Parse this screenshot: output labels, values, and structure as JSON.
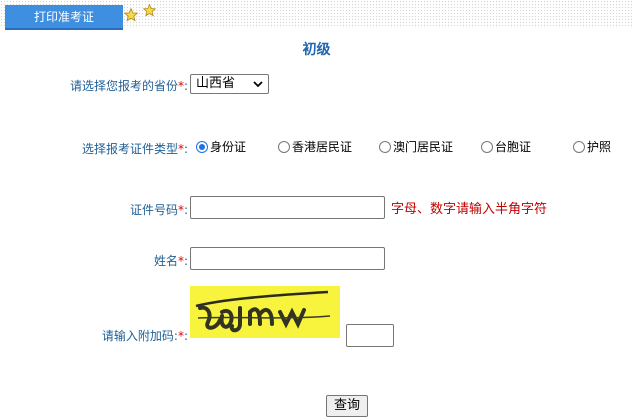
{
  "header": {
    "tab_label": "打印准考证"
  },
  "page_title": "初级",
  "form": {
    "province": {
      "label": "请选择您报考的省份",
      "required_mark": "*",
      "colon": ":",
      "value": "山西省"
    },
    "id_type": {
      "label": "选择报考证件类型",
      "required_mark": "*",
      "colon": ":",
      "options": [
        "身份证",
        "香港居民证",
        "澳门居民证",
        "台胞证",
        "护照"
      ],
      "selected_index": 0
    },
    "id_number": {
      "label": "证件号码",
      "required_mark": "*",
      "colon": ":",
      "value": "",
      "hint": "字母、数字请输入半角字符"
    },
    "name": {
      "label": "姓名",
      "required_mark": "*",
      "colon": ":",
      "value": ""
    },
    "captcha": {
      "label": "请输入附加码:",
      "required_mark": "*",
      "colon": ":",
      "value": ""
    },
    "submit_label": "查询"
  },
  "colors": {
    "tab": "#3f8fe0",
    "title": "#2066b1",
    "label": "#1f5f96",
    "required": "#e00000",
    "hint": "#c00000",
    "captcha_bg": "#f8f43d"
  }
}
